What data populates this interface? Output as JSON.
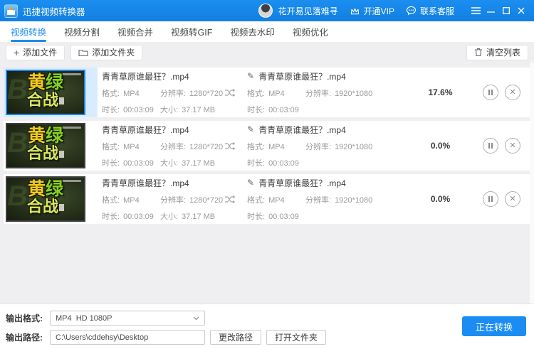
{
  "titlebar": {
    "app_title": "迅捷视频转换器",
    "username": "花开易见落难寻",
    "vip_label": "开通VIP",
    "support_label": "联系客服"
  },
  "tabs": [
    {
      "label": "视频转换",
      "active": true
    },
    {
      "label": "视频分割",
      "active": false
    },
    {
      "label": "视频合并",
      "active": false
    },
    {
      "label": "视频转GIF",
      "active": false
    },
    {
      "label": "视频去水印",
      "active": false
    },
    {
      "label": "视频优化",
      "active": false
    }
  ],
  "toolbar": {
    "add_file": "添加文件",
    "add_folder": "添加文件夹",
    "clear_list": "清空列表"
  },
  "labels": {
    "format": "格式:",
    "resolution": "分辨率:",
    "duration": "时长:",
    "size": "大小:"
  },
  "thumbnail": {
    "word_yellow": "黄",
    "word_green": "绿",
    "word_bottom": "合战",
    "watermark": "BE"
  },
  "rows": [
    {
      "source": {
        "name": "青青草原谁最狂？.mp4",
        "format": "MP4",
        "resolution": "1280*720",
        "duration": "00:03:09",
        "size": "37.17 MB"
      },
      "output": {
        "name": "青青草原谁最狂？.mp4",
        "format": "MP4",
        "resolution": "1920*1080",
        "duration": "00:03:09"
      },
      "progress": "17.6%"
    },
    {
      "source": {
        "name": "青青草原谁最狂？.mp4",
        "format": "MP4",
        "resolution": "1280*720",
        "duration": "00:03:09",
        "size": "37.17 MB"
      },
      "output": {
        "name": "青青草原谁最狂？.mp4",
        "format": "MP4",
        "resolution": "1920*1080",
        "duration": "00:03:09"
      },
      "progress": "0.0%"
    },
    {
      "source": {
        "name": "青青草原谁最狂？.mp4",
        "format": "MP4",
        "resolution": "1280*720",
        "duration": "00:03:09",
        "size": "37.17 MB"
      },
      "output": {
        "name": "青青草原谁最狂？.mp4",
        "format": "MP4",
        "resolution": "1920*1080",
        "duration": "00:03:09"
      },
      "progress": "0.0%"
    }
  ],
  "footer": {
    "format_label": "输出格式:",
    "format_value": "MP4  HD 1080P",
    "path_label": "输出路径:",
    "path_value": "C:\\Users\\cddehsy\\Desktop",
    "change_path_button": "更改路径",
    "open_folder_button": "打开文件夹",
    "convert_button": "正在转换"
  },
  "colors": {
    "accent_blue": "#1a8cee",
    "titlebar_blue": "#1587e8",
    "selected_highlight": "#d8ecfe"
  }
}
